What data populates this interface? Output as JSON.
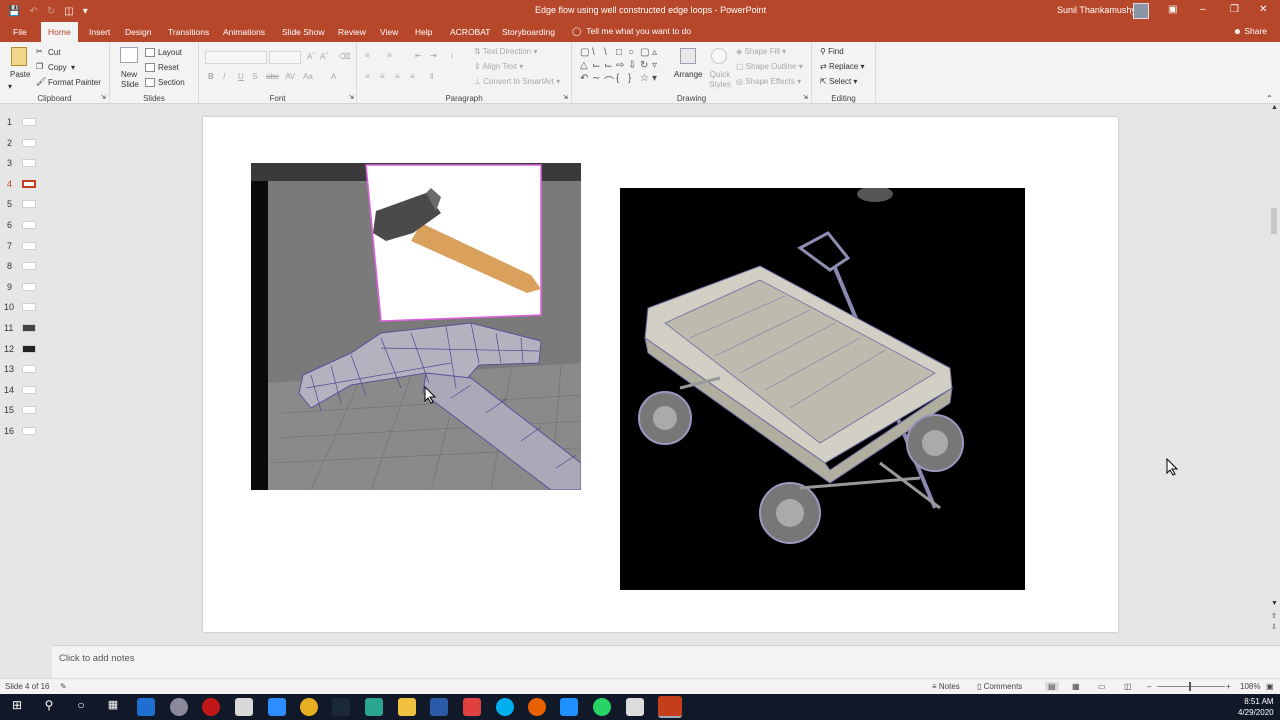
{
  "window": {
    "title": "Edge flow using well constructed edge loops  -  PowerPoint",
    "user": "Sunil Thankamushy"
  },
  "tabs": [
    "File",
    "Home",
    "Insert",
    "Design",
    "Transitions",
    "Animations",
    "Slide Show",
    "Review",
    "View",
    "Help",
    "ACROBAT",
    "Storyboarding"
  ],
  "active_tab": "Home",
  "tell_me": "Tell me what you want to do",
  "share": "Share",
  "ribbon": {
    "clipboard": {
      "paste": "Paste",
      "cut": "Cut",
      "copy": "Copy",
      "format_painter": "Format Painter",
      "label": "Clipboard"
    },
    "slides": {
      "new_slide": "New Slide",
      "layout": "Layout",
      "reset": "Reset",
      "section": "Section",
      "label": "Slides"
    },
    "font": {
      "label": "Font"
    },
    "paragraph": {
      "text_direction": "Text Direction",
      "align_text": "Align Text",
      "convert": "Convert to SmartArt",
      "label": "Paragraph"
    },
    "drawing": {
      "arrange": "Arrange",
      "quick_styles": "Quick Styles",
      "shape_fill": "Shape Fill",
      "shape_outline": "Shape Outline",
      "shape_effects": "Shape Effects",
      "label": "Drawing"
    },
    "editing": {
      "find": "Find",
      "replace": "Replace",
      "select": "Select",
      "label": "Editing"
    }
  },
  "thumbnails": [
    "1",
    "2",
    "3",
    "4",
    "5",
    "6",
    "7",
    "8",
    "9",
    "10",
    "11",
    "12",
    "13",
    "14",
    "15",
    "16"
  ],
  "active_slide": 4,
  "notes_placeholder": "Click to add notes",
  "status": {
    "slide_info": "Slide 4 of 16",
    "notes": "Notes",
    "comments": "Comments",
    "zoom": "108%"
  },
  "clock": {
    "time": "8:51 AM",
    "date": "4/29/2020"
  }
}
